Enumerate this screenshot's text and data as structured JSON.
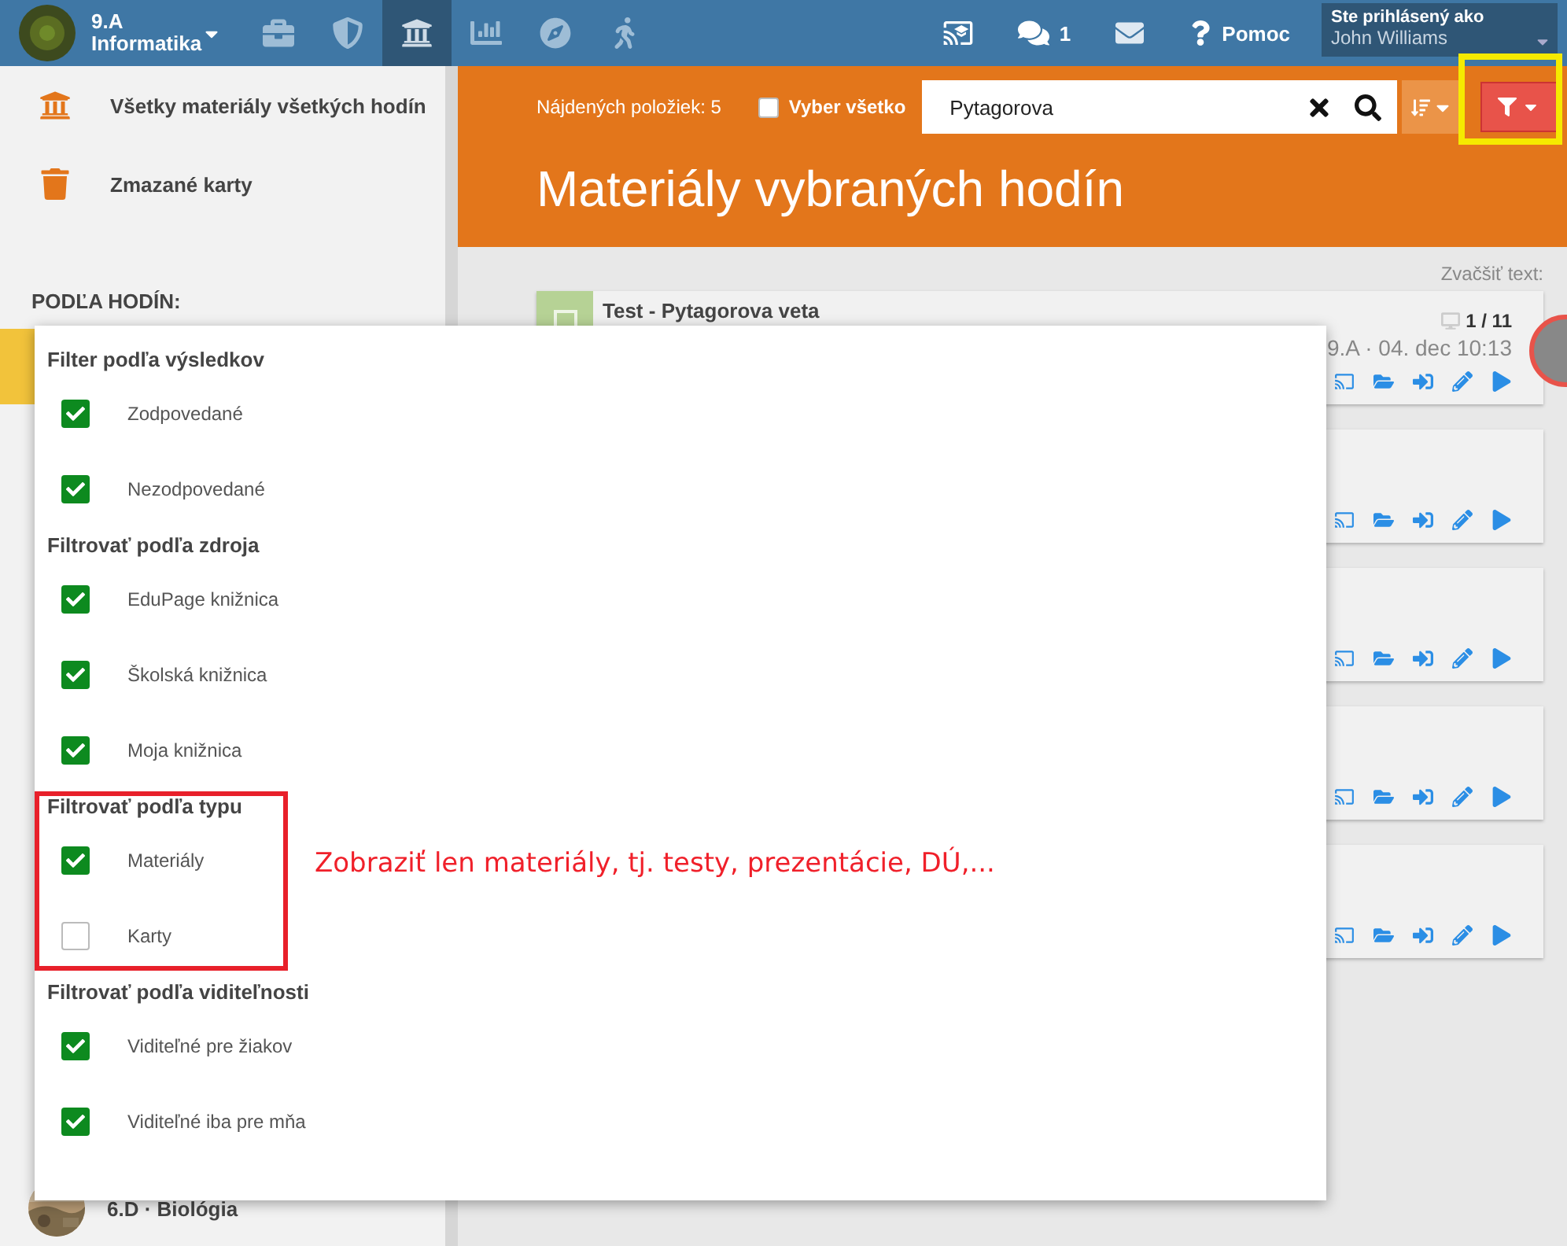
{
  "topbar": {
    "class_name": "9.A",
    "subject": "Informatika",
    "nav": [
      {
        "kind": "briefcase",
        "selected": false
      },
      {
        "kind": "shield",
        "selected": false
      },
      {
        "kind": "library",
        "selected": true
      },
      {
        "kind": "chart",
        "selected": false
      },
      {
        "kind": "compass",
        "selected": false
      },
      {
        "kind": "walk",
        "selected": false
      }
    ],
    "messages_count": "1",
    "help": "Pomoc",
    "user": {
      "caption": "Ste prihlásený ako",
      "name": "John Williams"
    }
  },
  "sidebar": {
    "items": [
      {
        "kind": "library",
        "label": "Všetky materiály všetkých hodín"
      },
      {
        "kind": "trash",
        "label": "Zmazané karty"
      }
    ],
    "section_title": "PODĽA HODÍN:",
    "lessons": [
      {
        "selected": true
      },
      {
        "label": "6.D · Biológia",
        "selected": false
      }
    ]
  },
  "toolbar": {
    "found": "Nájdených položiek: 5",
    "select_all": {
      "label": "Vyber všetko",
      "checked": false
    },
    "search": {
      "value": "Pytagorova"
    },
    "filter_active": true
  },
  "title": "Materiály vybraných hodín",
  "zoom_label": "Zvačšiť text:",
  "cards": [
    {
      "kind": "test",
      "title": "Test - Pytagorova veta",
      "count": "1 / 11",
      "meta": "9.A · 04. dec 10:13"
    },
    {
      "kind": "plain"
    },
    {
      "kind": "plain"
    },
    {
      "kind": "plain"
    },
    {
      "kind": "plain"
    }
  ],
  "filter_menu": {
    "sections": [
      {
        "title": "Filter podľa výsledkov",
        "options": [
          {
            "label": "Zodpovedané",
            "checked": true
          },
          {
            "label": "Nezodpovedané",
            "checked": true
          }
        ]
      },
      {
        "title": "Filtrovať podľa zdroja",
        "options": [
          {
            "label": "EduPage knižnica",
            "checked": true
          },
          {
            "label": "Školská knižnica",
            "checked": true
          },
          {
            "label": "Moja knižnica",
            "checked": true
          }
        ]
      },
      {
        "title": "Filtrovať podľa typu",
        "options": [
          {
            "label": "Materiály",
            "checked": true
          },
          {
            "label": "Karty",
            "checked": false
          }
        ]
      },
      {
        "title": "Filtrovať podľa viditeľnosti",
        "options": [
          {
            "label": "Viditeľné pre žiakov",
            "checked": true
          },
          {
            "label": "Viditeľné iba pre mňa",
            "checked": true
          }
        ]
      }
    ]
  },
  "annotation": {
    "text": "Zobraziť len materiály, tj. testy, prezentácie, DÚ,..."
  }
}
